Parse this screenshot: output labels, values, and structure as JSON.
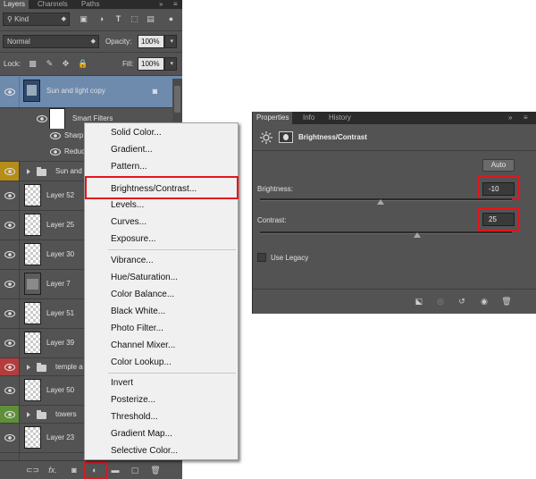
{
  "layers_panel": {
    "tabs": [
      "Layers",
      "Channels",
      "Paths"
    ],
    "collapse_glyph": "»",
    "menu_glyph": "≡",
    "filter": {
      "kind_label": "Kind",
      "icons": [
        "image-filter-icon",
        "adjustment-filter-icon",
        "type-filter-icon",
        "shape-filter-icon",
        "smart-object-filter-icon"
      ]
    },
    "blend_mode": "Normal",
    "opacity_label": "Opacity:",
    "opacity_value": "100%",
    "lock_label": "Lock:",
    "fill_label": "Fill:",
    "fill_value": "100%",
    "layers": [
      {
        "name": "Sun and light copy",
        "type": "smart",
        "selected": true
      },
      {
        "name": "Smart Filters",
        "type": "smart-filters"
      },
      {
        "name": "Sharp",
        "type": "filter"
      },
      {
        "name": "Reduc",
        "type": "filter"
      },
      {
        "name": "Sun and",
        "type": "group",
        "eye_color": "#b68d18"
      },
      {
        "name": "Layer 52",
        "type": "layer"
      },
      {
        "name": "Layer 25",
        "type": "layer"
      },
      {
        "name": "Layer 30",
        "type": "layer"
      },
      {
        "name": "Layer 7",
        "type": "layer"
      },
      {
        "name": "Layer 51",
        "type": "layer"
      },
      {
        "name": "Layer 39",
        "type": "layer"
      },
      {
        "name": "temple a",
        "type": "group",
        "eye_color": "#b53c3c"
      },
      {
        "name": "Layer 50",
        "type": "layer"
      },
      {
        "name": "towers",
        "type": "group",
        "eye_color": "#5f8f3a"
      },
      {
        "name": "Layer 23",
        "type": "layer"
      }
    ],
    "bottom_icons": [
      "link-layers-icon",
      "fx-icon",
      "layer-mask-icon",
      "new-adjustment-layer-icon",
      "new-group-icon",
      "new-layer-icon",
      "delete-layer-icon"
    ],
    "fx_label": "fx."
  },
  "adjust_menu": {
    "groups": [
      [
        "Solid Color...",
        "Gradient...",
        "Pattern..."
      ],
      [
        "Brightness/Contrast...",
        "Levels...",
        "Curves...",
        "Exposure..."
      ],
      [
        "Vibrance...",
        "Hue/Saturation...",
        "Color Balance...",
        "Black  White...",
        "Photo Filter...",
        "Channel Mixer...",
        "Color Lookup..."
      ],
      [
        "Invert",
        "Posterize...",
        "Threshold...",
        "Gradient Map...",
        "Selective Color..."
      ]
    ],
    "highlighted": "Brightness/Contrast..."
  },
  "properties_panel": {
    "tabs": [
      "Properties",
      "Info",
      "History"
    ],
    "title": "Brightness/Contrast",
    "auto_label": "Auto",
    "brightness_label": "Brightness:",
    "brightness_value": "-10",
    "brightness_norm": 0.48,
    "contrast_label": "Contrast:",
    "contrast_value": "25",
    "contrast_norm": 0.625,
    "use_legacy_label": "Use Legacy",
    "bottom_icons": [
      "clip-to-layer-icon",
      "view-previous-icon",
      "reset-icon",
      "visibility-icon",
      "delete-icon"
    ]
  },
  "colors": {
    "panel_bg": "#535353",
    "selection": "#6e8bae",
    "highlight_red": "#e3141c"
  }
}
